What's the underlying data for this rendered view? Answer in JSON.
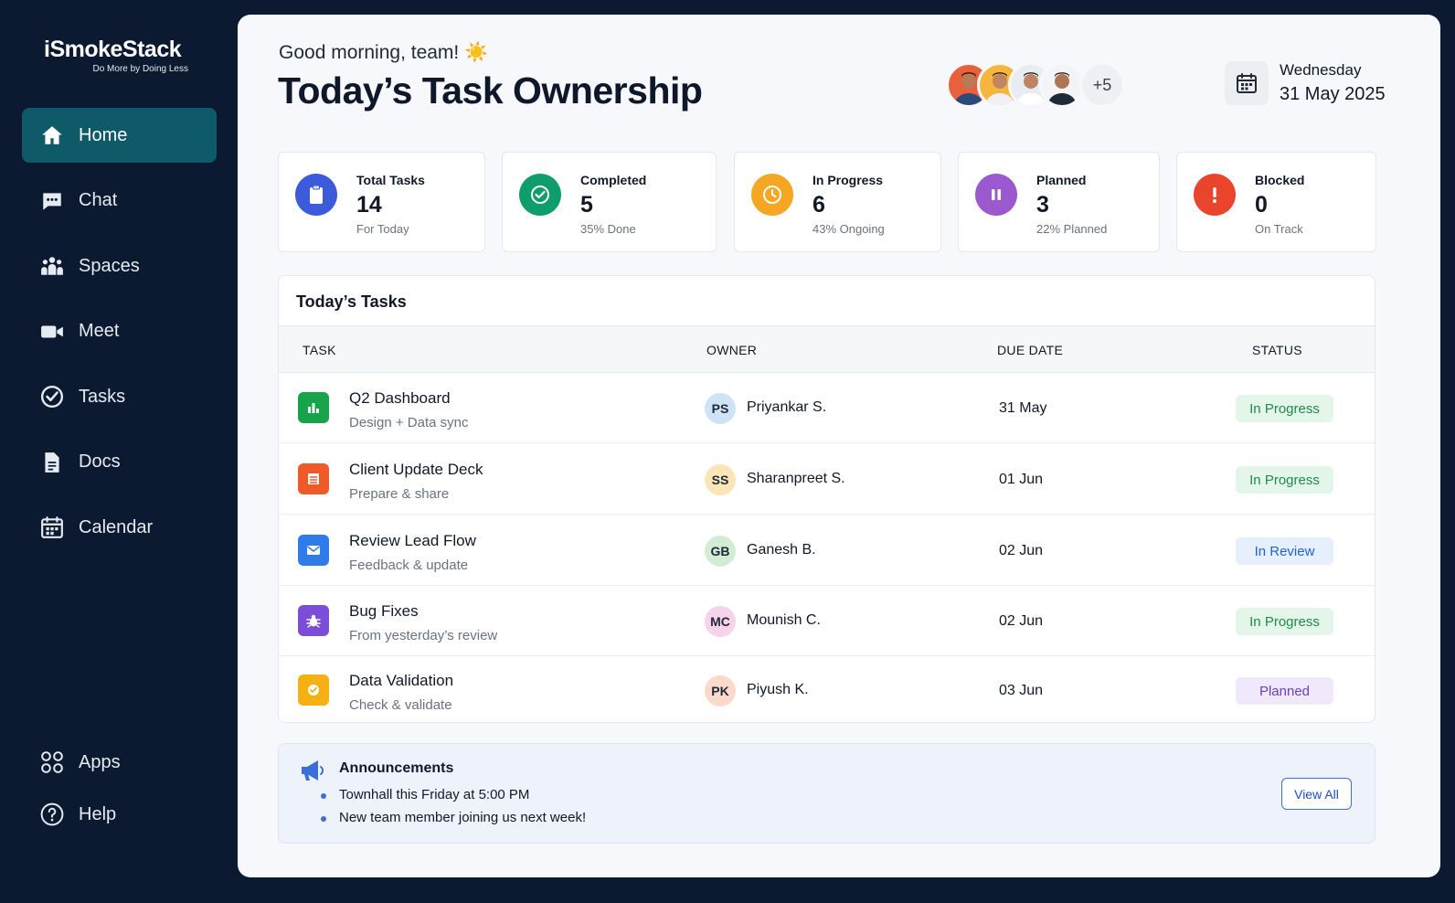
{
  "app": {
    "name": "iSmokeStack",
    "tagline": "Do More by Doing Less"
  },
  "sidebar": {
    "items": [
      {
        "label": "Home",
        "icon": "home-icon",
        "active": true
      },
      {
        "label": "Chat",
        "icon": "chat-icon"
      },
      {
        "label": "Spaces",
        "icon": "people-icon"
      },
      {
        "label": "Meet",
        "icon": "video-icon"
      },
      {
        "label": "Tasks",
        "icon": "check-circle-icon"
      },
      {
        "label": "Docs",
        "icon": "document-icon"
      },
      {
        "label": "Calendar",
        "icon": "calendar-icon"
      }
    ],
    "bottom": [
      {
        "label": "Apps",
        "icon": "apps-grid-icon"
      },
      {
        "label": "Help",
        "icon": "help-icon"
      }
    ]
  },
  "header": {
    "greeting": "Good morning, team! ☀️",
    "title": "Today’s Task Ownership",
    "more_members": "+5",
    "weekday": "Wednesday",
    "date": "31 May 2025"
  },
  "stats": [
    {
      "label": "Total Tasks",
      "value": "14",
      "sub": "For Today",
      "color": "#3b5bdb",
      "icon": "clipboard-icon"
    },
    {
      "label": "Completed",
      "value": "5",
      "sub": "35% Done",
      "color": "#0f9d6b",
      "icon": "check-icon"
    },
    {
      "label": "In Progress",
      "value": "6",
      "sub": "43% Ongoing",
      "color": "#f5a623",
      "icon": "clock-icon"
    },
    {
      "label": "Planned",
      "value": "3",
      "sub": "22% Planned",
      "color": "#9b59d0",
      "icon": "pause-icon"
    },
    {
      "label": "Blocked",
      "value": "0",
      "sub": "On Track",
      "color": "#e8452c",
      "icon": "alert-icon"
    }
  ],
  "tasks": {
    "title": "Today’s Tasks",
    "columns": [
      "TASK",
      "OWNER",
      "DUE DATE",
      "STATUS"
    ],
    "rows": [
      {
        "name": "Q2 Dashboard",
        "desc": "Design + Data sync",
        "initials": "PS",
        "owner": "Priyankar S.",
        "due": "31 May",
        "status": "In Progress",
        "kind": "progress",
        "icon_color": "#16a34a",
        "avatar_color": "#cfe3f7"
      },
      {
        "name": "Client Update Deck",
        "desc": "Prepare & share",
        "initials": "SS",
        "owner": "Sharanpreet S.",
        "due": "01 Jun",
        "status": "In Progress",
        "kind": "progress",
        "icon_color": "#f05a28",
        "avatar_color": "#fbe4b8"
      },
      {
        "name": "Review Lead Flow",
        "desc": "Feedback & update",
        "initials": "GB",
        "owner": "Ganesh B.",
        "due": "02 Jun",
        "status": "In Review",
        "kind": "review",
        "icon_color": "#2f7bea",
        "avatar_color": "#d3ecd6"
      },
      {
        "name": "Bug Fixes",
        "desc": "From yesterday’s review",
        "initials": "MC",
        "owner": "Mounish C.",
        "due": "02 Jun",
        "status": "In Progress",
        "kind": "progress",
        "icon_color": "#7c4dd6",
        "avatar_color": "#f6d3ea"
      },
      {
        "name": "Data Validation",
        "desc": "Check & validate",
        "initials": "PK",
        "owner": "Piyush K.",
        "due": "03 Jun",
        "status": "Planned",
        "kind": "planned",
        "icon_color": "#f5b014",
        "avatar_color": "#fbd9cc"
      }
    ]
  },
  "announcements": {
    "title": "Announcements",
    "items": [
      "Townhall this Friday at 5:00 PM",
      "New team member joining us next week!"
    ],
    "button": "View All"
  }
}
